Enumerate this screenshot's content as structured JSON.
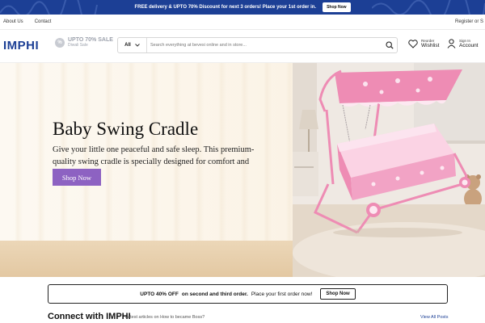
{
  "top_banner": {
    "promo_text": "FREE delivery & UPTO 70% Discount for next 3 orders! Place your 1st order in.",
    "shop_now": "Shop Now"
  },
  "utility_nav": {
    "about": "About Us",
    "contact": "Contact",
    "register": "Register or S"
  },
  "header": {
    "logo": "IMPHI",
    "sale_title": "UPTO 70% SALE",
    "sale_subtitle": "Diwali Sale",
    "search_category": "All",
    "search_placeholder": "Search everything at bevesi online and in store...",
    "wishlist_small": "Reorder",
    "wishlist_big": "Wishlist",
    "account_small": "Sign In",
    "account_big": "Account"
  },
  "hero": {
    "title": "Baby Swing Cradle",
    "description": "Give your little one peaceful and safe sleep. This premium-quality swing cradle is specially designed for comfort and safety.",
    "cta": "Shop Now"
  },
  "promo_strip": {
    "highlight": "UPTO 40% OFF",
    "bold_text": "on second and third order.",
    "text": "Place your first order now!",
    "button": "Shop Now"
  },
  "connect": {
    "title": "Connect with IMPHI",
    "latest": "Latest articles on How to became Boss?",
    "view_all": "View All Posts"
  },
  "colors": {
    "brand_blue": "#1c3f95",
    "cta_purple": "#8d62c2",
    "cradle_pink": "#ee8cb4"
  }
}
